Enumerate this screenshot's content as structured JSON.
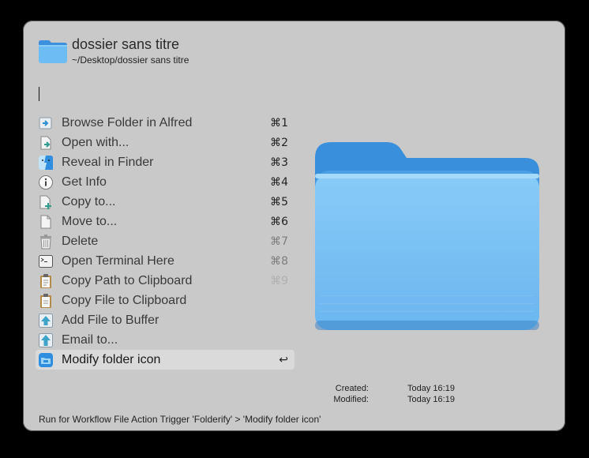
{
  "header": {
    "icon": "folder-icon",
    "title": "dossier sans titre",
    "path": "~/Desktop/dossier sans titre"
  },
  "search": {
    "value": ""
  },
  "actions": [
    {
      "label": "Browse Folder in Alfred",
      "shortcut": "⌘1",
      "icon": "browse-folder-icon"
    },
    {
      "label": "Open with...",
      "shortcut": "⌘2",
      "icon": "open-with-icon"
    },
    {
      "label": "Reveal in Finder",
      "shortcut": "⌘3",
      "icon": "finder-icon"
    },
    {
      "label": "Get Info",
      "shortcut": "⌘4",
      "icon": "info-icon"
    },
    {
      "label": "Copy to...",
      "shortcut": "⌘5",
      "icon": "copy-to-icon"
    },
    {
      "label": "Move to...",
      "shortcut": "⌘6",
      "icon": "move-to-icon"
    },
    {
      "label": "Delete",
      "shortcut": "⌘7",
      "icon": "trash-icon"
    },
    {
      "label": "Open Terminal Here",
      "shortcut": "⌘8",
      "icon": "terminal-icon"
    },
    {
      "label": "Copy Path to Clipboard",
      "shortcut": "⌘9",
      "icon": "clipboard-path-icon"
    },
    {
      "label": "Copy File to Clipboard",
      "shortcut": "",
      "icon": "clipboard-file-icon"
    },
    {
      "label": "Add File to Buffer",
      "shortcut": "",
      "icon": "buffer-add-icon"
    },
    {
      "label": "Email to...",
      "shortcut": "",
      "icon": "email-icon"
    },
    {
      "label": "Modify folder icon",
      "shortcut": "↩",
      "icon": "folderify-icon",
      "selected": true
    }
  ],
  "preview": {
    "icon": "folder-large-icon"
  },
  "meta": {
    "created_label": "Created:",
    "created_value": "Today 16:19",
    "modified_label": "Modified:",
    "modified_value": "Today 16:19"
  },
  "footer": "Run for Workflow File Action Trigger 'Folderify' > 'Modify folder icon'",
  "colors": {
    "window_bg": "#c9c9c9",
    "selected_row_bg": "#dadada",
    "folder_light": "#7cc4f5",
    "folder_dark": "#3b8fdb"
  }
}
